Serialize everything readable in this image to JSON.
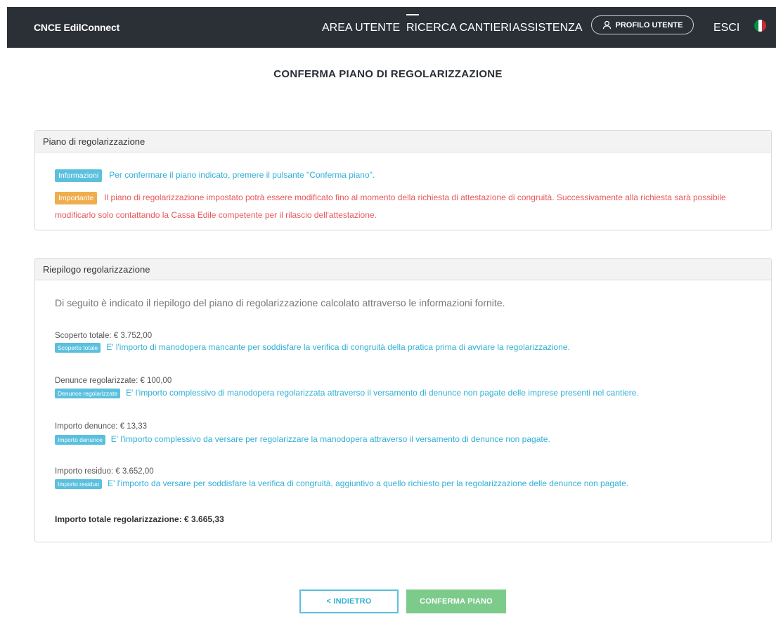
{
  "header": {
    "brand": "CNCE EdilConnect",
    "nav": [
      {
        "label": "AREA UTENTE"
      },
      {
        "label": "RICERCA CANTIERI"
      },
      {
        "label": "ASSISTENZA"
      }
    ],
    "profile_label": "PROFILO UTENTE",
    "logout_label": "ESCI",
    "flag_colors": [
      "#009246",
      "#ffffff",
      "#ce2b37"
    ]
  },
  "page": {
    "title": "CONFERMA PIANO DI REGOLARIZZAZIONE"
  },
  "panel_plan": {
    "title": "Piano di regolarizzazione",
    "info_badge": "Informazioni",
    "info_text": "Per confermare il piano indicato, premere il pulsante \"Conferma piano\".",
    "warn_badge": "Importante",
    "warn_text_line1": "Il piano di regolarizzazione impostato potrà essere modificato fino al momento della richiesta di attestazione di congruità. Successivamente alla richiesta sarà possibile",
    "warn_text_line2": "modificarlo solo contattando la Cassa Edile competente per il rilascio dell'attestazione."
  },
  "panel_summary": {
    "title": "Riepilogo regolarizzazione",
    "intro": "Di seguito è indicato il riepilogo del piano di regolarizzazione calcolato attraverso le informazioni fornite.",
    "items": [
      {
        "label": "Scoperto totale: € 3.752,00",
        "badge": "Scoperto totale",
        "desc": "E' l'importo di manodopera mancante per soddisfare la verifica di congruità della pratica prima di avviare la regolarizzazione."
      },
      {
        "label": "Denunce regolarizzate: € 100,00",
        "badge": "Denunce regolarizzate",
        "desc": "E' l'importo complessivo di manodopera regolarizzata attraverso il versamento di denunce non pagate delle imprese presenti nel cantiere."
      },
      {
        "label": "Importo denunce: € 13,33",
        "badge": "Importo denunce",
        "desc": "E' l'importo complessivo da versare per regolarizzare la manodopera attraverso il versamento di denunce non pagate."
      },
      {
        "label": "Importo residuo: € 3.652,00",
        "badge": "Importo residuo",
        "desc": "E' l'importo da versare per soddisfare la verifica di congruità, aggiuntivo a quello richiesto per la regolarizzazione delle denunce non pagate."
      }
    ],
    "total": "Importo totale regolarizzazione: € 3.665,33"
  },
  "actions": {
    "back_label": "< INDIETRO",
    "confirm_label": "CONFERMA PIANO"
  },
  "colors": {
    "header_bg": "#2b2f36",
    "info": "#5bc0de",
    "warning": "#f0ad4e",
    "danger_text": "#e8575a",
    "success": "#7ccb8b"
  }
}
